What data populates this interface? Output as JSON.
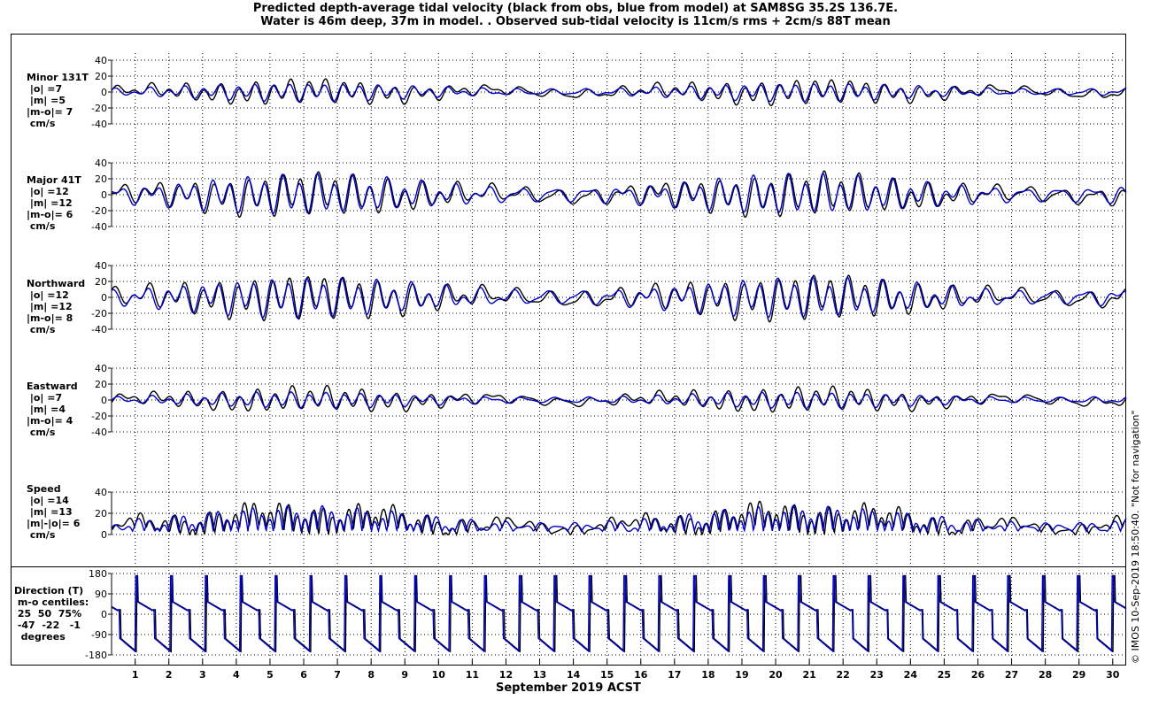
{
  "title_line1": "Predicted depth-average tidal velocity (black from obs, blue from model) at SAM8SG 35.2S 136.7E.",
  "title_line2": "Water is 46m deep, 37m in model. . Observed sub-tidal velocity is 11cm/s rms + 2cm/s 88T mean",
  "xlabel": "September 2019 ACST",
  "credit": "© IMOS 10-Sep-2019 18:50:40. \"Not for navigation\"",
  "colors": {
    "obs": "#000000",
    "model": "#0000cc"
  },
  "panels": [
    {
      "id": "minor",
      "label": "Minor 131T\n |o| =7\n |m| =5\n|m-o|= 7\n cm/s",
      "ylim": [
        -40,
        40
      ],
      "yticks": [
        -40,
        -20,
        0,
        20,
        40
      ]
    },
    {
      "id": "major",
      "label": "Major 41T\n |o| =12\n |m| =12\n|m-o|= 6\n cm/s",
      "ylim": [
        -40,
        40
      ],
      "yticks": [
        -40,
        -20,
        0,
        20,
        40
      ]
    },
    {
      "id": "north",
      "label": "Northward\n |o| =12\n |m| =12\n|m-o|= 8\n cm/s",
      "ylim": [
        -40,
        40
      ],
      "yticks": [
        -40,
        -20,
        0,
        20,
        40
      ]
    },
    {
      "id": "east",
      "label": "Eastward\n |o| =7\n |m| =4\n|m-o|= 4\n cm/s",
      "ylim": [
        -40,
        40
      ],
      "yticks": [
        -40,
        -20,
        0,
        20,
        40
      ]
    },
    {
      "id": "speed",
      "label": "Speed\n |o| =14\n |m| =13\n|m|-|o|= 6\n cm/s",
      "ylim": [
        0,
        40
      ],
      "yticks": [
        0,
        20,
        40
      ]
    },
    {
      "id": "dir",
      "label": "Direction (T)\n m-o centiles:\n 25  50  75%\n -47  -22   -1\n  degrees",
      "ylim": [
        -180,
        180
      ],
      "yticks": [
        -180,
        -90,
        0,
        90,
        180
      ]
    }
  ],
  "chart_data": {
    "type": "line",
    "x_range_days": [
      0.3,
      30.4
    ],
    "x_ticks": [
      "1",
      "2",
      "3",
      "4",
      "5",
      "6",
      "7",
      "8",
      "9",
      "10",
      "11",
      "12",
      "13",
      "14",
      "15",
      "16",
      "17",
      "18",
      "19",
      "20",
      "21",
      "22",
      "23",
      "24",
      "25",
      "26",
      "27",
      "28",
      "29",
      "30"
    ],
    "grid": true,
    "series": [
      {
        "name": "obs",
        "amplitude_cm_s": {
          "minor": 12,
          "major": 21,
          "north": 22,
          "east": 12
        }
      },
      {
        "name": "model",
        "amplitude_cm_s": {
          "minor": 9,
          "major": 20,
          "north": 20,
          "east": 8
        }
      }
    ]
  }
}
